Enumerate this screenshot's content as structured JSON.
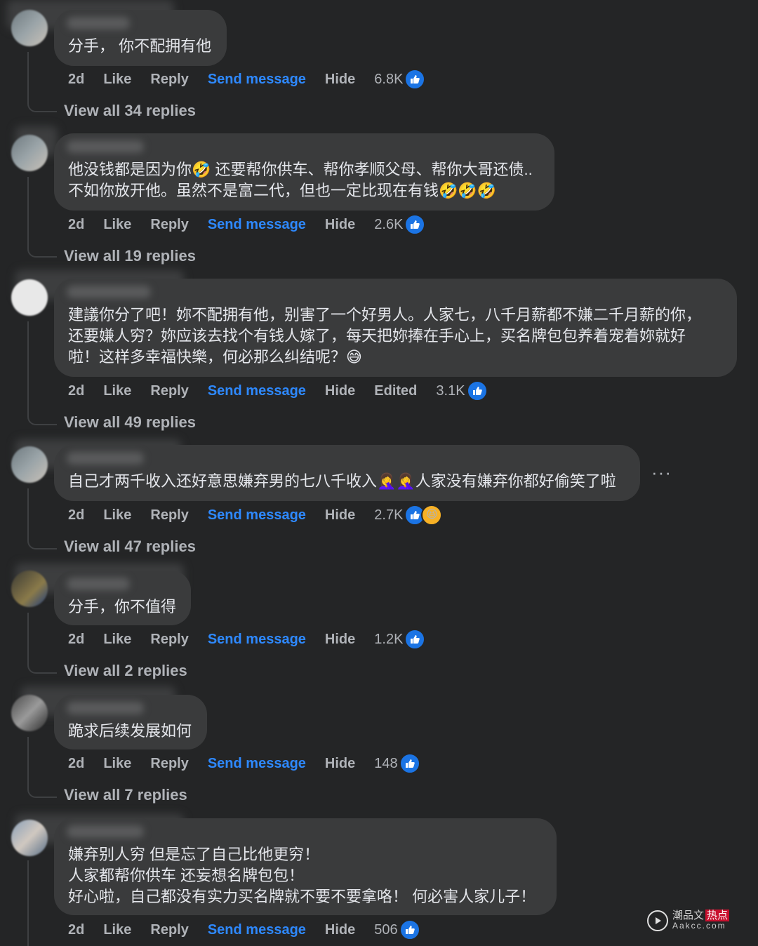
{
  "actions": {
    "time": "2d",
    "like": "Like",
    "reply": "Reply",
    "send": "Send message",
    "hide": "Hide",
    "edited": "Edited"
  },
  "comments": [
    {
      "text": "分手， 你不配拥有他",
      "count": "6.8K",
      "reactions": [
        "like"
      ],
      "view": "View all 34 replies"
    },
    {
      "text": "他没钱都是因为你🤣 还要帮你供车、帮你孝顺父母、帮你大哥还债..\n不如你放开他。虽然不是富二代，但也一定比现在有钱🤣🤣🤣",
      "count": "2.6K",
      "reactions": [
        "like"
      ],
      "view": "View all 19 replies"
    },
    {
      "text": "建議你分了吧！妳不配拥有他，别害了一个好男人。人家七，八千月薪都不嫌二千月薪的你，\n还要嫌人穷？妳应该去找个有钱人嫁了，每天把妳捧在手心上，买名牌包包养着宠着妳就好\n啦！这样多幸福快樂，何必那么纠结呢？😅",
      "count": "3.1K",
      "reactions": [
        "like"
      ],
      "edited": true,
      "view": "View all 49 replies"
    },
    {
      "text": "自己才两千收入还好意思嫌弃男的七八千收入🤦‍♀️🤦‍♀️人家没有嫌弃你都好偷笑了啦",
      "count": "2.7K",
      "reactions": [
        "like",
        "haha"
      ],
      "view": "View all 47 replies",
      "more": "···"
    },
    {
      "text": "分手，你不值得",
      "count": "1.2K",
      "reactions": [
        "like"
      ],
      "view": "View all 2 replies"
    },
    {
      "text": "跪求后续发展如何",
      "count": "148",
      "reactions": [
        "like"
      ],
      "view": "View all 7 replies"
    },
    {
      "text": "嫌弃别人穷 但是忘了自己比他更穷！\n人家都帮你供车 还妄想名牌包包！\n好心啦，自己都没有实力买名牌就不要不要拿咯！ 何必害人家儿子！",
      "count": "506",
      "reactions": [
        "like"
      ]
    }
  ],
  "watermark": {
    "line1": "潮品文",
    "badge": "热点",
    "line2": "Aakcc.com"
  },
  "colors": {
    "background": "#242526",
    "bubble": "#3a3b3c",
    "link": "#2e89ff",
    "like": "#1b74e4"
  }
}
